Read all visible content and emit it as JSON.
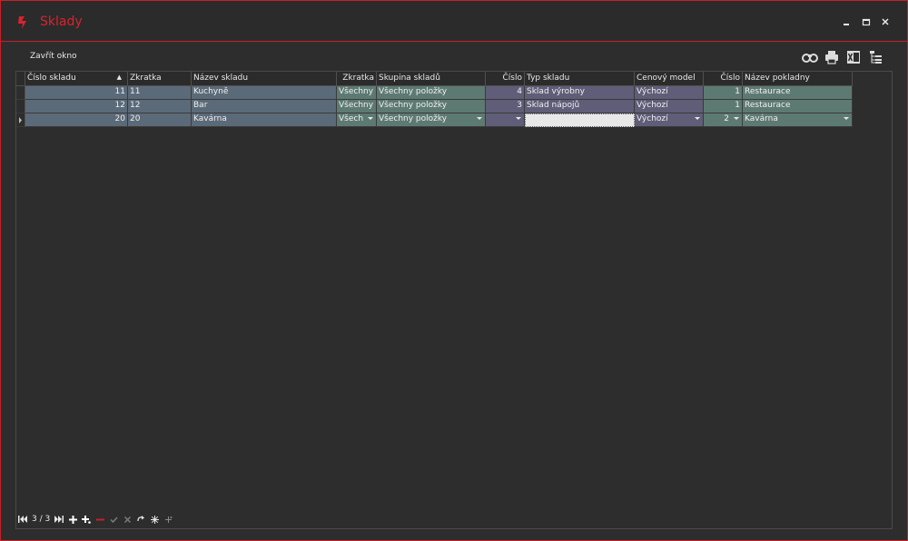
{
  "window": {
    "title": "Sklady",
    "accent_color": "#d8232e",
    "icons": [
      "app-logo-icon",
      "minimize-icon",
      "maximize-icon",
      "close-icon"
    ]
  },
  "toolbar": {
    "close_label": "Zavřít okno",
    "icons": [
      "binoculars-icon",
      "print-icon",
      "excel-icon",
      "tree-icon"
    ]
  },
  "grid": {
    "columns": [
      "Číslo skladu",
      "Zkratka",
      "Název skladu",
      "Zkratka",
      "Skupina skladů",
      "Číslo",
      "Typ skladu",
      "Cenový model",
      "Číslo",
      "Název pokladny"
    ],
    "sort_indicator": "▲",
    "rows": [
      [
        "11",
        "11",
        "Kuchyně",
        "Všechny p",
        "Všechny položky",
        "4",
        "Sklad výrobny",
        "Výchozí",
        "1",
        "Restaurace"
      ],
      [
        "12",
        "12",
        "Bar",
        "Všechny p",
        "Všechny položky",
        "3",
        "Sklad nápojů",
        "Výchozí",
        "1",
        "Restaurace"
      ],
      [
        "20",
        "20",
        "Kavárna",
        "Všech",
        "Všechny položky",
        "",
        "",
        "Výchozí",
        "2",
        "Kavárna"
      ]
    ]
  },
  "navigator": {
    "position": "3 / 3",
    "icons": [
      "first-record-icon",
      "last-record-icon",
      "add-icon",
      "add-copy-icon",
      "delete-icon",
      "confirm-icon",
      "cancel-icon",
      "refresh-icon",
      "filter-icon",
      "more-icon"
    ]
  }
}
